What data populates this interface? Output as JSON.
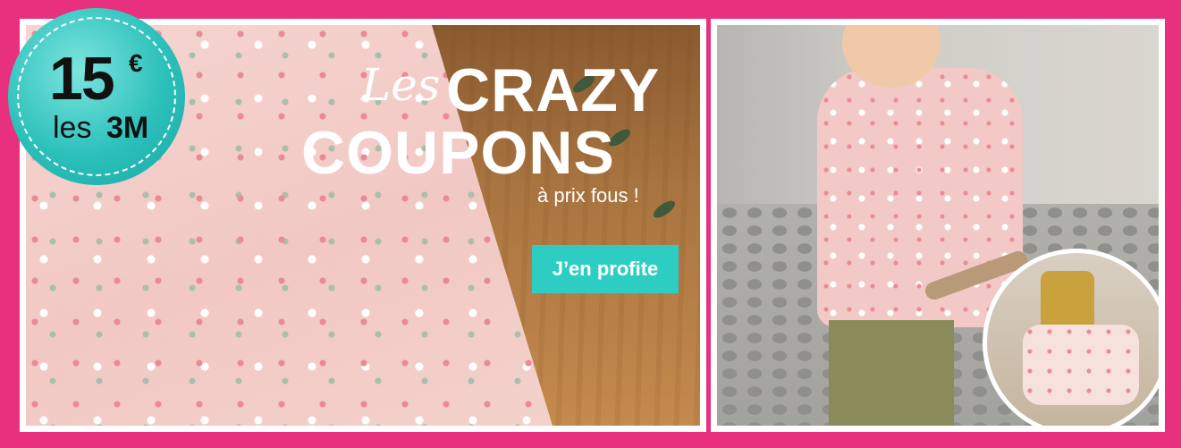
{
  "badge": {
    "price": "15",
    "currency": "€",
    "qty_prefix": "les",
    "qty": "3M"
  },
  "headline": {
    "script": "Les",
    "line1": "CRAZY",
    "line2": "COUPONS",
    "sub": "à prix fous !"
  },
  "cta": {
    "label": "J’en profite"
  },
  "colors": {
    "frame": "#e8307e",
    "badge": "#2cc0bb",
    "button": "#2ecdc4"
  }
}
